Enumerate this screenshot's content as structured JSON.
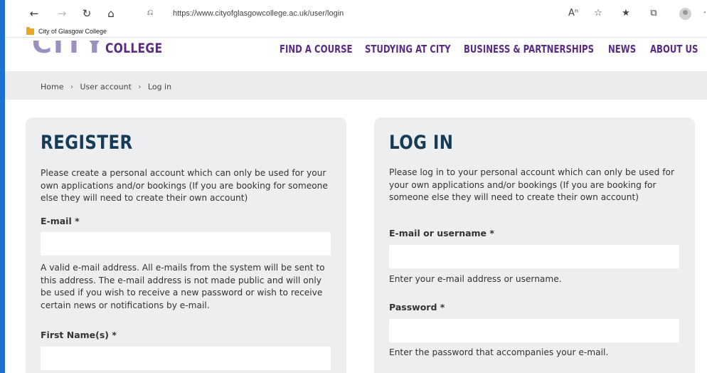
{
  "browser": {
    "url": "https://www.cityofglasgowcollege.ac.uk/user/login",
    "favorites_label": "City of Glasgow College"
  },
  "site": {
    "logo_city": "CITY",
    "logo_college": "COLLEGE",
    "nav": [
      "FIND A COURSE",
      "STUDYING AT CITY",
      "BUSINESS & PARTNERSHIPS",
      "NEWS",
      "ABOUT US"
    ]
  },
  "breadcrumb": [
    "Home",
    "User account",
    "Log in"
  ],
  "register": {
    "title": "REGISTER",
    "intro": "Please create a personal account which can only be used for your own applications and/or bookings (If you are booking for someone else they will need to create their own account)",
    "email_label": "E-mail *",
    "email_value": "",
    "email_help": "A valid e-mail address. All e-mails from the system will be sent to this address. The e-mail address is not made public and will only be used if you wish to receive a new password or wish to receive certain news or notifications by e-mail.",
    "firstname_label": "First Name(s) *",
    "firstname_value": ""
  },
  "login": {
    "title": "LOG IN",
    "intro": "Please log in to your personal account which can only be used for your own applications and/or bookings (If you are booking for someone else they will need to create their own account)",
    "username_label": "E-mail or username *",
    "username_value": "",
    "username_help": "Enter your e-mail address or username.",
    "password_label": "Password *",
    "password_value": "",
    "password_help": "Enter the password that accompanies your e-mail."
  },
  "colors": {
    "brand_purple": "#5a2d82",
    "heading_navy": "#163b57",
    "panel_bg": "#eceef0",
    "accent_blue": "#1f6fd1"
  }
}
